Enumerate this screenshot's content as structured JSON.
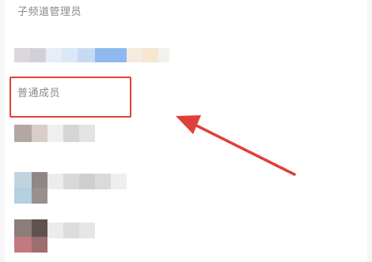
{
  "sections": {
    "sub_channel_admins": {
      "label": "子频道管理员"
    },
    "normal_members": {
      "label": "普通成员"
    }
  },
  "annotation": {
    "highlight_color": "#e0403a",
    "arrow_color": "#e0403a"
  }
}
